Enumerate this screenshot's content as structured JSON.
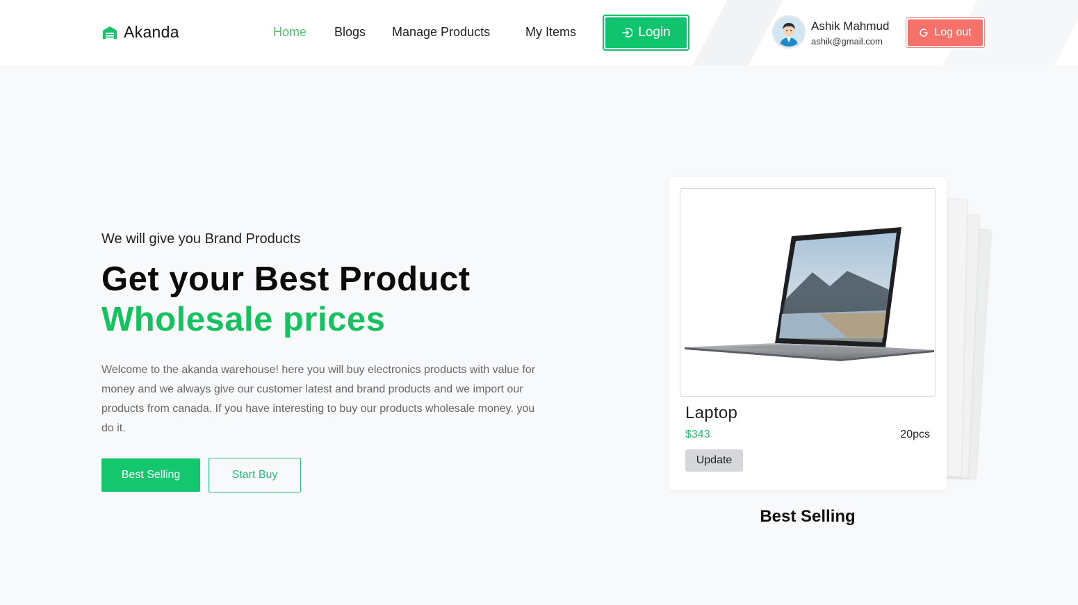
{
  "header": {
    "brand": "Akanda",
    "nav": [
      {
        "label": "Home",
        "active": true
      },
      {
        "label": "Blogs"
      },
      {
        "label": "Manage Products"
      },
      {
        "label": "My Items"
      }
    ],
    "login_label": "Login",
    "user": {
      "name": "Ashik Mahmud",
      "email": "ashik@gmail.com"
    },
    "logout_label": "Log out"
  },
  "hero": {
    "subtitle": "We will give you Brand Products",
    "title_line1": "Get your Best Product",
    "title_line2": "Wholesale prices",
    "description": "Welcome to the akanda warehouse! here you will buy electronics products with value for money and we always give our customer latest and brand products and we import our products from canada. If you have interesting to buy our products wholesale money. you do it.",
    "primary_button": "Best Selling",
    "secondary_button": "Start Buy"
  },
  "product_card": {
    "name": "Laptop",
    "price": "$343",
    "quantity": "20pcs",
    "update_label": "Update"
  },
  "best_selling_heading": "Best Selling",
  "colors": {
    "accent_green": "#14c76e",
    "nav_active": "#4cc36f",
    "logout_red": "#f4726a",
    "background": "#f8f9fb"
  }
}
